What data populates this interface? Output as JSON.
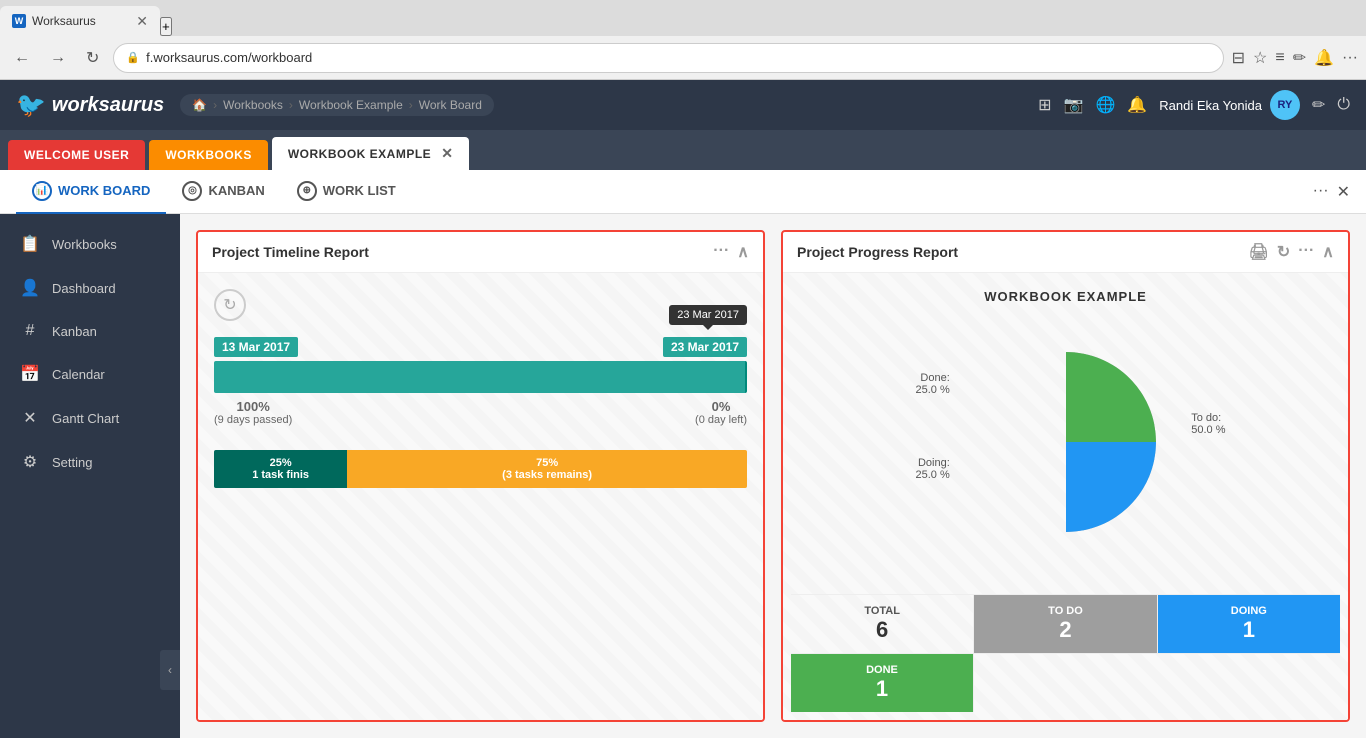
{
  "browser": {
    "tab_label": "Worksaurus",
    "url": "f.worksaurus.com/workboard",
    "new_tab_symbol": "+",
    "nav_back": "←",
    "nav_forward": "→",
    "nav_refresh": "↻"
  },
  "app": {
    "logo": "worksaurus",
    "breadcrumb": [
      "🏠",
      "Workbooks",
      "Workbook Example",
      "Work Board"
    ],
    "header_icons": [
      "⊞",
      "📷",
      "🌐",
      "🔔"
    ],
    "user_name": "Randi Eka Yonida",
    "tabs": [
      {
        "label": "WELCOME USER",
        "style": "red"
      },
      {
        "label": "WORKBOOKS",
        "style": "orange"
      },
      {
        "label": "WORKBOOK EXAMPLE",
        "style": "active-white",
        "closable": true
      }
    ]
  },
  "sub_tabs": [
    {
      "label": "WORK BOARD",
      "active": true,
      "icon": "chart"
    },
    {
      "label": "KANBAN",
      "active": false,
      "icon": "circle"
    },
    {
      "label": "WORK LIST",
      "active": false,
      "icon": "list"
    }
  ],
  "sidebar": {
    "items": [
      {
        "label": "Workbooks",
        "icon": "📋"
      },
      {
        "label": "Dashboard",
        "icon": "👤"
      },
      {
        "label": "Kanban",
        "icon": "+"
      },
      {
        "label": "Calendar",
        "icon": "📅"
      },
      {
        "label": "Gantt Chart",
        "icon": "✕"
      },
      {
        "label": "Setting",
        "icon": "⚙"
      }
    ],
    "collapse_icon": "‹"
  },
  "timeline_card": {
    "title": "Project Timeline Report",
    "start_date": "13 Mar 2017",
    "end_date": "23 Mar 2017",
    "tooltip_date": "23 Mar 2017",
    "left_percent": "100%",
    "left_sub": "(9 days passed)",
    "right_percent": "0%",
    "right_sub": "(0 day left)",
    "progress_left_pct": "25%",
    "progress_left_sub": "1 task finis",
    "progress_right_pct": "75%",
    "progress_right_sub": "(3 tasks remains)"
  },
  "progress_card": {
    "title": "Project Progress Report",
    "chart_title": "WORKBOOK EXAMPLE",
    "pie_segments": [
      {
        "label": "Done:",
        "value": "25.0 %",
        "color": "#4caf50",
        "angle_start": 0,
        "angle_end": 90
      },
      {
        "label": "Doing:",
        "value": "25.0 %",
        "color": "#2196f3",
        "angle_start": 90,
        "angle_end": 180
      },
      {
        "label": "To do:",
        "value": "50.0 %",
        "color": "#9e9e9e",
        "angle_start": 180,
        "angle_end": 360
      }
    ],
    "stats": [
      {
        "label": "TOTAL",
        "value": "6",
        "style": "normal"
      },
      {
        "label": "TO DO",
        "value": "2",
        "style": "gray"
      },
      {
        "label": "DOING",
        "value": "1",
        "style": "blue"
      }
    ],
    "stats2": [
      {
        "label": "DONE",
        "value": "1",
        "style": "green"
      }
    ]
  }
}
